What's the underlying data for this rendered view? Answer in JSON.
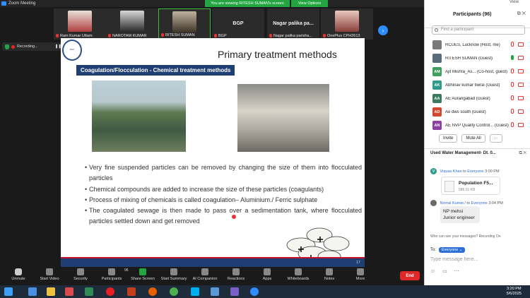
{
  "window": {
    "title": "Zoom Meeting"
  },
  "banner": {
    "viewing": "You are viewing RITESH SUMAN's screen",
    "view_options": "View Options",
    "view": "View"
  },
  "video_tiles": [
    {
      "name": "Ram Kumar Uttam"
    },
    {
      "name": "NAROTAM KUMAR"
    },
    {
      "name": "RITESH SUMAN"
    },
    {
      "name": "BGP",
      "center": "BGP"
    },
    {
      "name": "Nagar palika parisha...",
      "center": "Nagar palika pa..."
    },
    {
      "name": "OnePlus CPH2613"
    }
  ],
  "recording": {
    "label": "Recording..."
  },
  "slide": {
    "logo_text": "BGP",
    "title": "Primary treatment methods",
    "subtitle": "Coagulation/Flocculation - Chemical treatment methods",
    "bullets": [
      "Very fine suspended particles can be removed  by changing the size of them into flocculated particles",
      "Chemical compounds are added to increase the size of these particles (coagulants)",
      "Process of mixing of chemicals is called coagulation– Aluminium./ Ferric sulphate",
      "The coagulated sewage is then made to pass over a sedimentation tank, where flocculated particles settled down and get removed"
    ],
    "page": "17"
  },
  "toolbar": {
    "items": [
      "Unmute",
      "Start Video",
      "Security",
      "Participants",
      "Share Screen",
      "Start Summary",
      "AI Companion",
      "Reactions",
      "Apps",
      "Whiteboards",
      "Notes",
      "More"
    ],
    "participants_count": "96",
    "end": "End"
  },
  "participants_panel": {
    "title": "Participants (96)",
    "search_placeholder": "Find a participant",
    "list": [
      {
        "initials": "",
        "name": "RCUES, Lucknow (Host, me)",
        "color": "#7a7a7a"
      },
      {
        "initials": "",
        "name": "RITESH SUMAN (Guest)",
        "color": "#5a6b7a"
      },
      {
        "initials": "AM",
        "name": "Ajit Mishra_As... (Co-host, guest)",
        "color": "#3f9f5f"
      },
      {
        "initials": "AK",
        "name": "Abhinav kumar tiwrai (Guest)",
        "color": "#2e9a8a"
      },
      {
        "initials": "AA",
        "name": "AE Aurangabad (Guest)",
        "color": "#3a7a5f"
      },
      {
        "initials": "AD",
        "name": "Ae dws south (Guest)",
        "color": "#d2462e"
      },
      {
        "initials": "AN",
        "name": "AE NVP Quality Control... (Guest)",
        "color": "#8c3fa0"
      }
    ],
    "invite": "Invite",
    "mute_all": "Mute All",
    "more": "···"
  },
  "chat": {
    "title": "Used Water Management-  Dt. 0...",
    "messages": [
      {
        "from": "Viquas Khan",
        "to": "Everyone",
        "time": "3:00 PM"
      },
      {
        "from": "Nirmal Kumar./",
        "to": "Everyone",
        "time": "3:04 PM"
      }
    ],
    "file": {
      "name": "Population F5...",
      "size": "586.01 KB"
    },
    "text_lines": [
      "NP mehsi",
      "Junior engineer"
    ],
    "who_can_see": "Who can see your messages? Recording On",
    "to_label": "To:",
    "to_value": "Everyone",
    "input_placeholder": "Type message here..."
  },
  "taskbar": {
    "time": "3:20 PM",
    "date": "5/6/2025"
  }
}
